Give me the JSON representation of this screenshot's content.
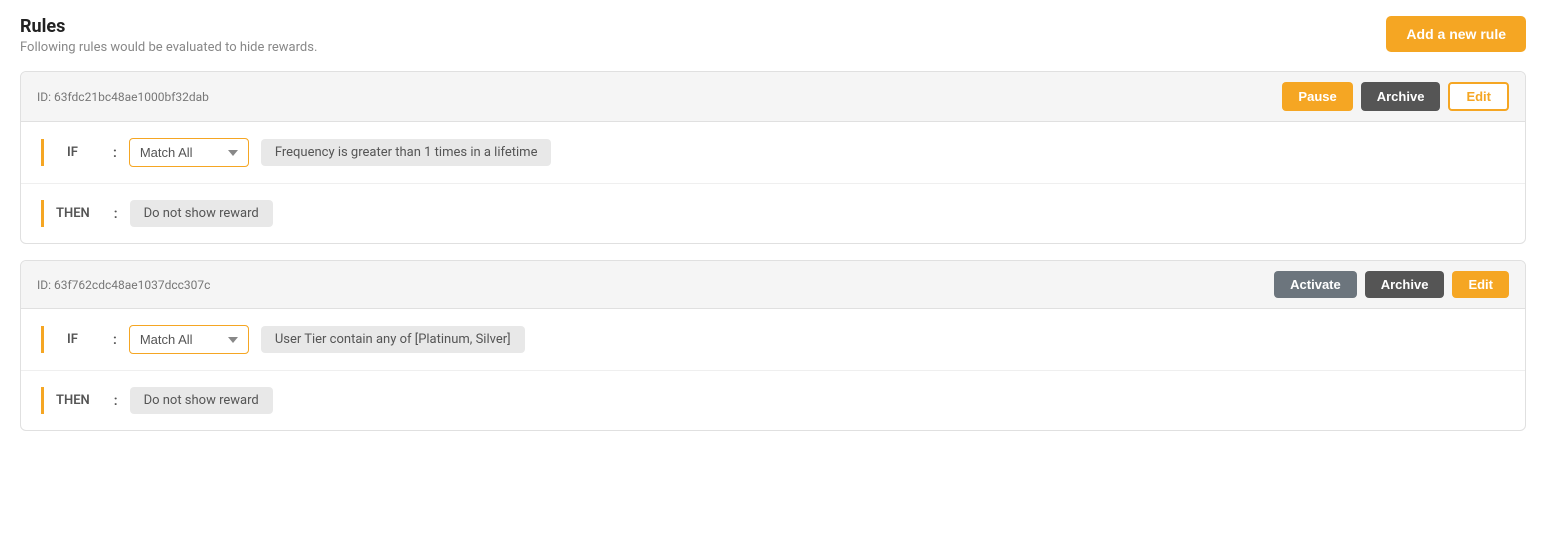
{
  "page": {
    "title": "Rules",
    "subtitle": "Following rules would be evaluated to hide rewards.",
    "add_rule_label": "Add a new rule"
  },
  "rules": [
    {
      "id": "ID: 63fdc21bc48ae1000bf32dab",
      "buttons": {
        "pause": "Pause",
        "archive": "Archive",
        "edit": "Edit"
      },
      "edit_style": "outline",
      "if_label": "IF",
      "colon1": ":",
      "match_all": "Match All",
      "condition": "Frequency is greater than 1 times in a lifetime",
      "then_label": "THEN",
      "colon2": ":",
      "action": "Do not show reward"
    },
    {
      "id": "ID: 63f762cdc48ae1037dcc307c",
      "buttons": {
        "activate": "Activate",
        "archive": "Archive",
        "edit": "Edit"
      },
      "edit_style": "filled",
      "if_label": "IF",
      "colon1": ":",
      "match_all": "Match All",
      "condition": "User Tier contain any of [Platinum, Silver]",
      "then_label": "THEN",
      "colon2": ":",
      "action": "Do not show reward"
    }
  ]
}
